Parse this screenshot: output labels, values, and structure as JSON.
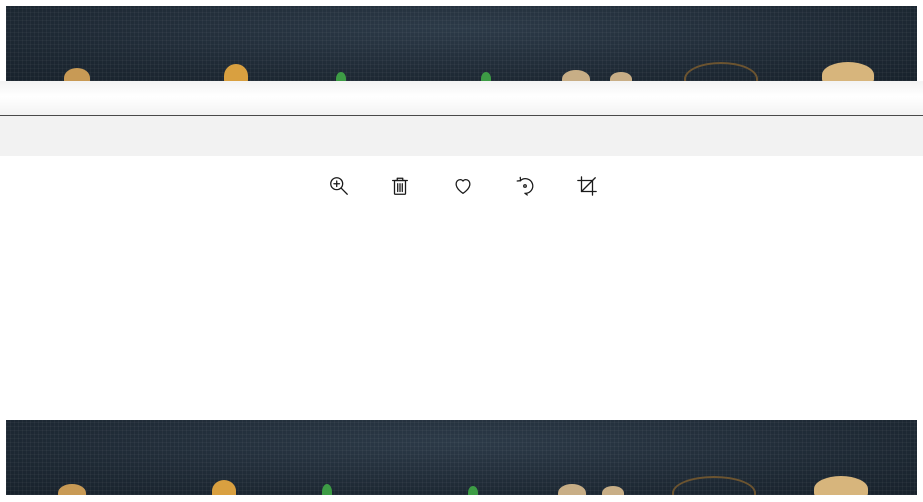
{
  "toolbar": {
    "buttons": [
      {
        "name": "zoom-in-button",
        "icon": "zoom-in-icon"
      },
      {
        "name": "delete-button",
        "icon": "trash-icon"
      },
      {
        "name": "favorite-button",
        "icon": "heart-icon"
      },
      {
        "name": "rotate-button",
        "icon": "rotate-icon"
      },
      {
        "name": "crop-button",
        "icon": "crop-icon"
      }
    ]
  },
  "colors": {
    "photo_background": "#1d2833",
    "toolbar_icon": "#1a1a1a",
    "separator_band": "#f2f2f2"
  }
}
